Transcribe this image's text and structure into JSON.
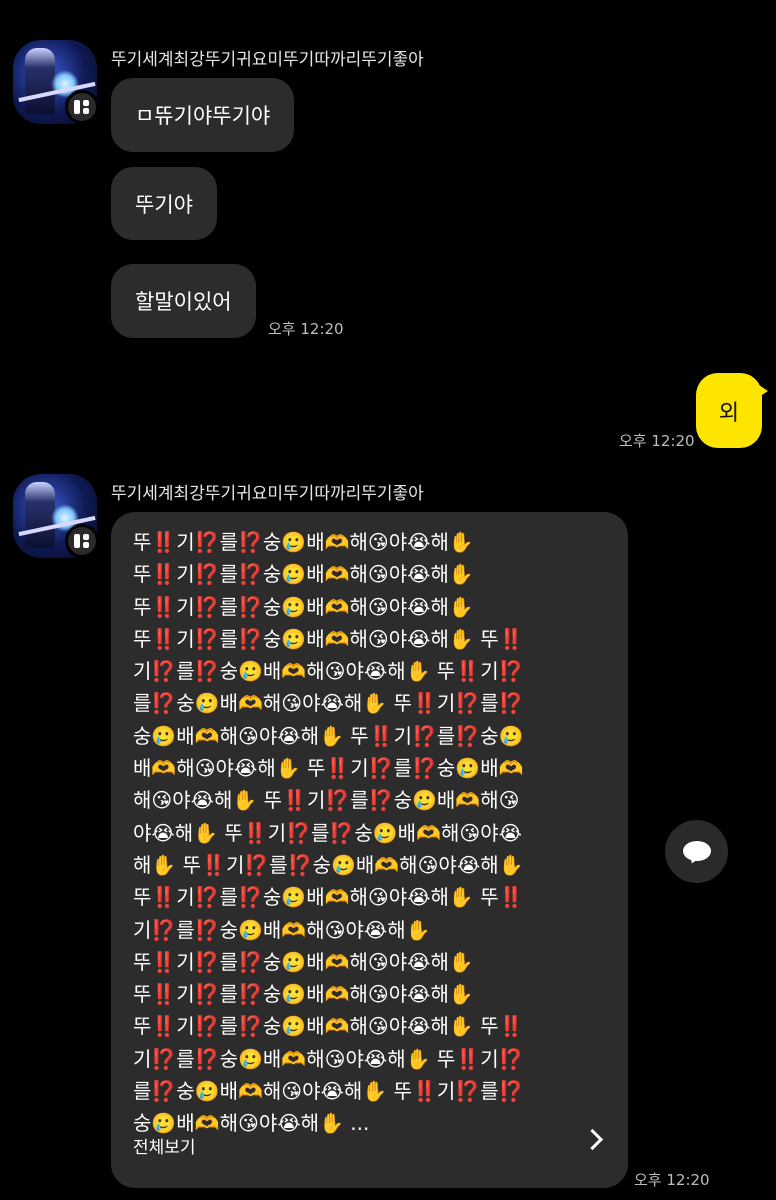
{
  "chat": {
    "sender_name_1": "뚜기세계최강뚜기귀요미뚜기따까리뚜기좋아",
    "msg1": "ㅁ뜌기야뚜기야",
    "msg2": "뚜기야",
    "msg3": "할말이있어",
    "time1": "오후 12:20",
    "my_msg": "외",
    "time2": "오후 12:20",
    "sender_name_2": "뚜기세계최강뚜기귀요미뚜기따까리뚜기좋아",
    "long_lines": [
      "뚜‼️기⁉️를⁉️숭🥲배🫶해😘야😭해✋",
      "뚜‼️기⁉️를⁉️숭🥲배🫶해😘야😭해✋",
      "뚜‼️기⁉️를⁉️숭🥲배🫶해😘야😭해✋",
      "뚜‼️기⁉️를⁉️숭🥲배🫶해😘야😭해✋ 뚜‼️",
      "기⁉️를⁉️숭🥲배🫶해😘야😭해✋ 뚜‼️기⁉️",
      "를⁉️숭🥲배🫶해😘야😭해✋ 뚜‼️기⁉️를⁉️",
      "숭🥲배🫶해😘야😭해✋ 뚜‼️기⁉️를⁉️숭🥲",
      "배🫶해😘야😭해✋ 뚜‼️기⁉️를⁉️숭🥲배🫶",
      "해😘야😭해✋ 뚜‼️기⁉️를⁉️숭🥲배🫶해😘",
      "야😭해✋ 뚜‼️기⁉️를⁉️숭🥲배🫶해😘야😭",
      "해✋ 뚜‼️기⁉️를⁉️숭🥲배🫶해😘야😭해✋",
      "뚜‼️기⁉️를⁉️숭🥲배🫶해😘야😭해✋ 뚜‼️",
      "기⁉️를⁉️숭🥲배🫶해😘야😭해✋",
      "뚜‼️기⁉️를⁉️숭🥲배🫶해😘야😭해✋",
      "뚜‼️기⁉️를⁉️숭🥲배🫶해😘야😭해✋",
      "뚜‼️기⁉️를⁉️숭🥲배🫶해😘야😭해✋ 뚜‼️",
      "기⁉️를⁉️숭🥲배🫶해😘야😭해✋ 뚜‼️기⁉️",
      "를⁉️숭🥲배🫶해😘야😭해✋ 뚜‼️기⁉️를⁉️",
      "숭🥲배🫶해😘야😭해✋ ..."
    ],
    "view_all": "전체보기",
    "time3": "오후 12:20"
  },
  "icons": {
    "badge": "profile-badge-icon",
    "share": "speech-bubble-icon",
    "chevron": "chevron-right-icon"
  },
  "colors": {
    "background": "#000000",
    "bubble": "#2c2c2c",
    "my_bubble": "#fee500"
  }
}
